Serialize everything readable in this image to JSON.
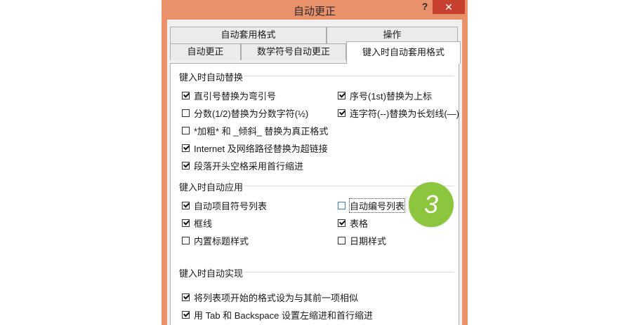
{
  "window": {
    "title": "自动更正",
    "help": "?",
    "close": "✕"
  },
  "tabs_row1": [
    "自动套用格式",
    "操作"
  ],
  "tabs_row2": [
    "自动更正",
    "数学符号自动更正",
    "键入时自动套用格式"
  ],
  "sections": {
    "replace": {
      "title": "键入时自动替换",
      "options": [
        {
          "label": "直引号替换为弯引号",
          "checked": true
        },
        {
          "label": "序号(1st)替换为上标",
          "checked": true
        },
        {
          "label": "分数(1/2)替换为分数字符(½)",
          "checked": false
        },
        {
          "label": "连字符(--)替换为长划线(—)",
          "checked": true
        },
        {
          "label": "*加粗* 和 _倾斜_ 替换为真正格式",
          "checked": false
        },
        {
          "label": "Internet 及网络路径替换为超链接",
          "checked": true
        },
        {
          "label": "段落开头空格采用首行缩进",
          "checked": true
        }
      ]
    },
    "apply": {
      "title": "键入时自动应用",
      "options": [
        {
          "label": "自动项目符号列表",
          "checked": true
        },
        {
          "label": "自动编号列表",
          "checked": false
        },
        {
          "label": "框线",
          "checked": true
        },
        {
          "label": "表格",
          "checked": true
        },
        {
          "label": "内置标题样式",
          "checked": false
        },
        {
          "label": "日期样式",
          "checked": false
        }
      ]
    },
    "implement": {
      "title": "键入时自动实现",
      "options": [
        {
          "label": "将列表项开始的格式设为与其前一项相似",
          "checked": true
        },
        {
          "label": "用 Tab 和 Backspace 设置左缩进和首行缩进",
          "checked": true
        }
      ]
    }
  },
  "badge": {
    "text": "3",
    "color": "#8cc63f"
  },
  "colors": {
    "titlebar": "#e9916a",
    "close": "#c7402f"
  }
}
